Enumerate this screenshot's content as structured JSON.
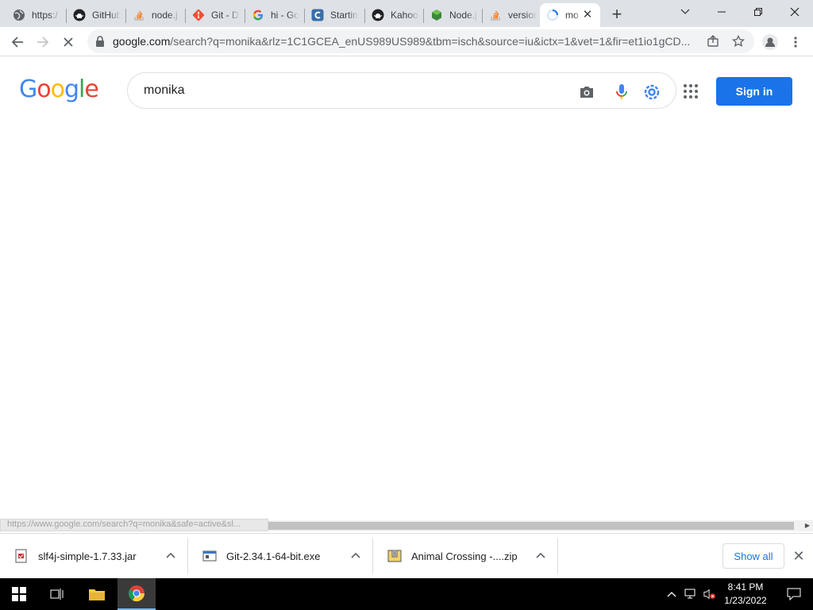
{
  "tabs": [
    {
      "title": "https:/",
      "icon": "globe-icon"
    },
    {
      "title": "GitHub",
      "icon": "github-icon"
    },
    {
      "title": "node.j",
      "icon": "stackoverflow-icon"
    },
    {
      "title": "Git - D",
      "icon": "git-icon"
    },
    {
      "title": "hi - Go",
      "icon": "google-g-icon"
    },
    {
      "title": "Startin",
      "icon": "app-c-icon"
    },
    {
      "title": "Kahoo",
      "icon": "github-icon"
    },
    {
      "title": "Node.j",
      "icon": "nodejs-icon"
    },
    {
      "title": "version",
      "icon": "stackoverflow-icon"
    },
    {
      "title": "mo",
      "icon": "loading-spinner-icon",
      "active": true
    }
  ],
  "toolbar": {
    "url_host": "google.com",
    "url_rest": "/search?q=monika&rlz=1C1GCEA_enUS989US989&tbm=isch&source=iu&ictx=1&vet=1&fir=et1io1gCD..."
  },
  "page": {
    "logo_letters": [
      {
        "ch": "G",
        "color": "#4285f4"
      },
      {
        "ch": "o",
        "color": "#ea4335"
      },
      {
        "ch": "o",
        "color": "#fbbc05"
      },
      {
        "ch": "g",
        "color": "#4285f4"
      },
      {
        "ch": "l",
        "color": "#34a853"
      },
      {
        "ch": "e",
        "color": "#ea4335"
      }
    ],
    "search_query": "monika",
    "signin_label": "Sign in"
  },
  "status": {
    "hover_url": "https://www.google.com/search?q=monika&safe=active&sl..."
  },
  "downloads": {
    "items": [
      {
        "name": "slf4j-simple-1.7.33.jar",
        "icon": "jar-file-icon"
      },
      {
        "name": "Git-2.34.1-64-bit.exe",
        "icon": "exe-file-icon"
      },
      {
        "name": "Animal Crossing -....zip",
        "icon": "zip-file-icon"
      }
    ],
    "show_all_label": "Show all"
  },
  "taskbar": {
    "time": "8:41 PM",
    "date": "1/23/2022"
  },
  "colors": {
    "accent": "#1a73e8",
    "tabstrip": "#dee1e6"
  }
}
